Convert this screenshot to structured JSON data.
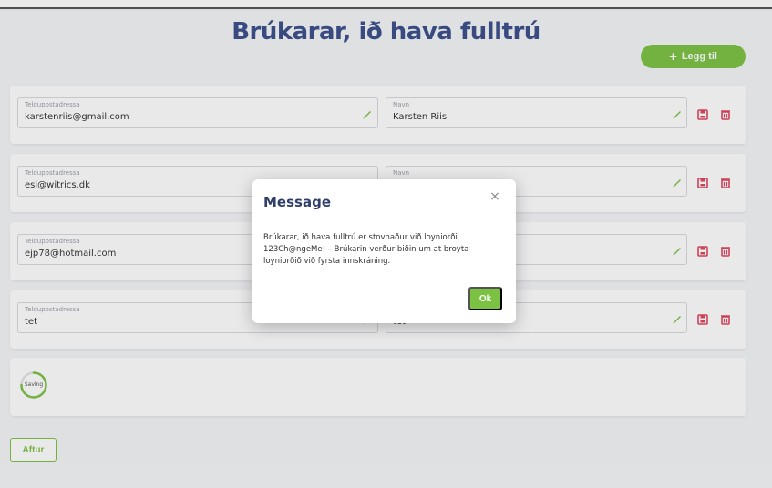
{
  "page": {
    "title": "Brúkarar, ið hava fulltrú",
    "add_label": "Legg til",
    "back_label": "Aftur"
  },
  "users": [
    {
      "email_label": "Teldupostadressa",
      "email": "karstenriis@gmail.com",
      "name_label": "Navn",
      "name": "Karsten Riis"
    },
    {
      "email_label": "Teldupostadressa",
      "email": "esi@witrics.dk",
      "name_label": "Navn",
      "name": ""
    },
    {
      "email_label": "Teldupostadressa",
      "email": "ejp78@hotmail.com",
      "name_label": "",
      "name": ""
    },
    {
      "email_label": "Teldupostadressa",
      "email": "tet",
      "name_label": "",
      "name": "tet"
    }
  ],
  "saving": {
    "label": "Saving"
  },
  "modal": {
    "title": "Message",
    "close": "×",
    "body": "Brúkarar, ið hava fulltrú er stovnaður við loyniorði 123Ch@ngeMe! – Brúkarin verður biðin um at broyta loyniorðið við fyrsta innskráning.",
    "ok_label": "Ok"
  },
  "colors": {
    "accent": "#7cc242",
    "title": "#3b4f8a",
    "danger": "#e0455b"
  }
}
